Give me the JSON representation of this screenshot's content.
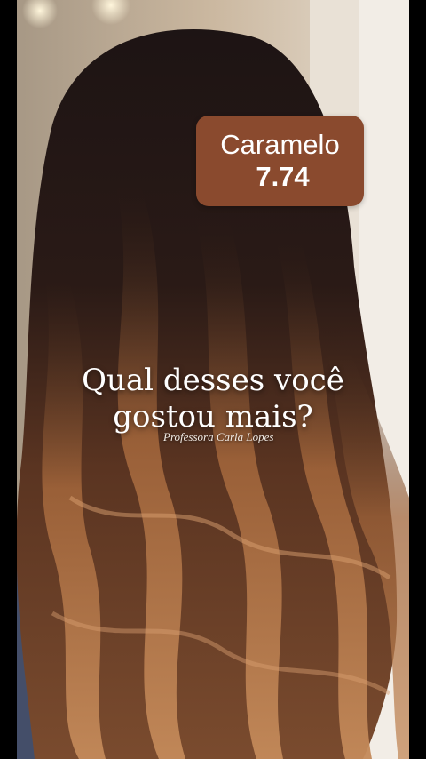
{
  "badge": {
    "name": "Caramelo",
    "code": "7.74",
    "color": "#8a4a2e"
  },
  "question": {
    "line1": "Qual desses você",
    "line2": "gostou mais?"
  },
  "credit": "Professora Carla Lopes"
}
